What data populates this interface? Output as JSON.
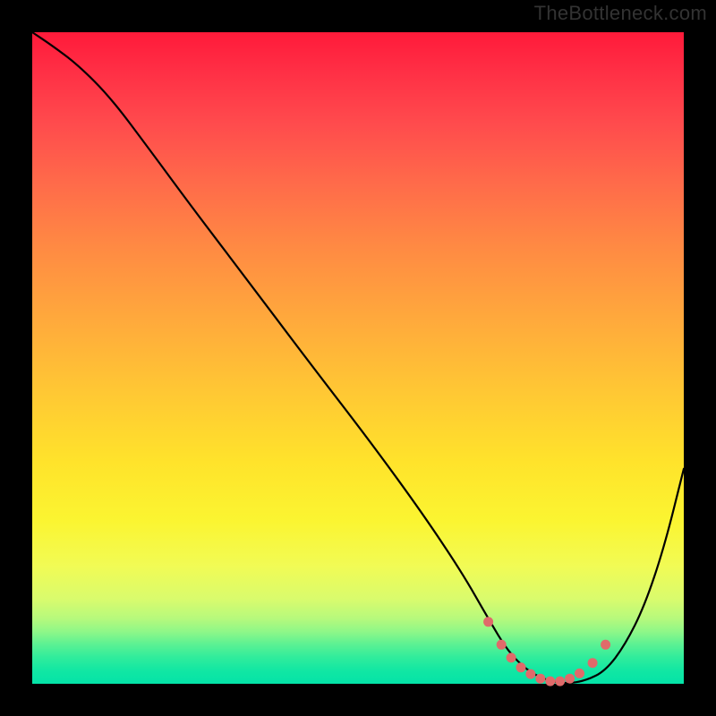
{
  "watermark": "TheBottleneck.com",
  "chart_data": {
    "type": "line",
    "title": "",
    "xlabel": "",
    "ylabel": "",
    "xlim": [
      0,
      100
    ],
    "ylim": [
      0,
      100
    ],
    "gradient_stops": [
      {
        "pos": 0,
        "color": "#ff1a3a"
      },
      {
        "pos": 14,
        "color": "#ff4b4d"
      },
      {
        "pos": 33,
        "color": "#ff8a43"
      },
      {
        "pos": 55,
        "color": "#ffc734"
      },
      {
        "pos": 75,
        "color": "#fbf531"
      },
      {
        "pos": 90,
        "color": "#b6f97c"
      },
      {
        "pos": 100,
        "color": "#04e3a8"
      }
    ],
    "series": [
      {
        "name": "bottleneck-curve",
        "color": "#000000",
        "x": [
          0,
          3,
          7,
          12,
          18,
          25,
          33,
          42,
          52,
          60,
          66,
          70,
          73,
          76,
          79,
          82,
          85,
          88,
          91,
          94,
          97,
          100
        ],
        "y": [
          100,
          98,
          95,
          90,
          82,
          72.5,
          62,
          50,
          37,
          26,
          17,
          10,
          5,
          2,
          0.5,
          0,
          0.5,
          2,
          6,
          12,
          21,
          33
        ]
      },
      {
        "name": "optimal-range",
        "color": "#e06a6a",
        "style": "dotted",
        "x": [
          70,
          72,
          73.5,
          75,
          76.5,
          78,
          79.5,
          81,
          82.5,
          84,
          86,
          88
        ],
        "y": [
          9.5,
          6,
          4,
          2.5,
          1.5,
          0.8,
          0.4,
          0.4,
          0.8,
          1.6,
          3.2,
          6
        ]
      }
    ]
  }
}
